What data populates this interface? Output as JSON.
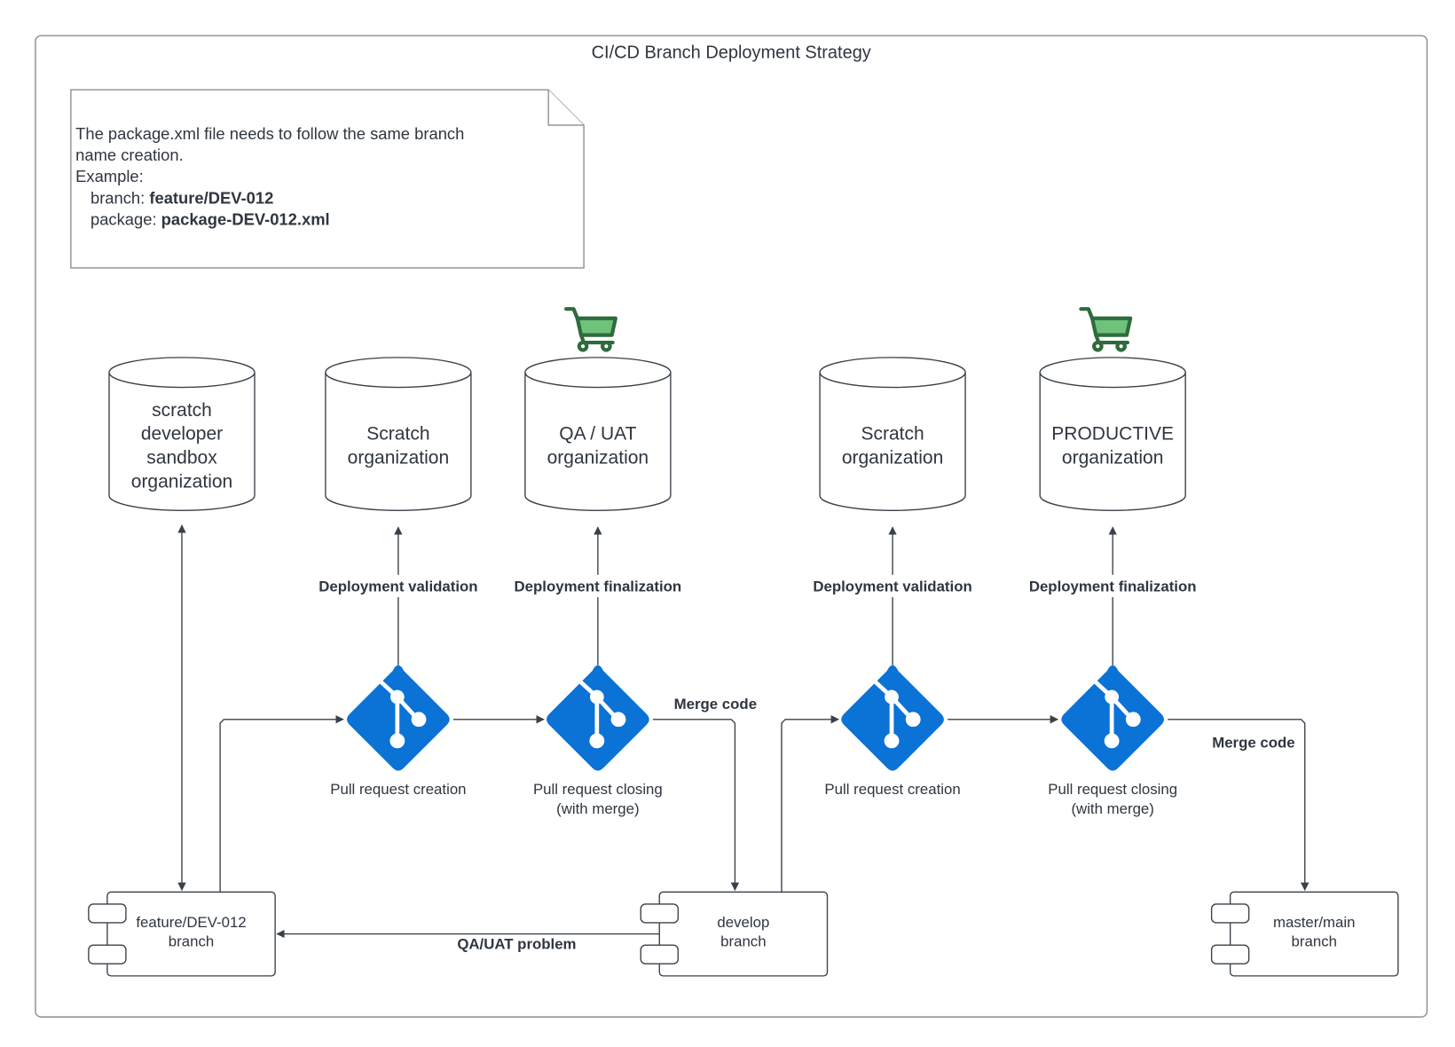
{
  "diagram": {
    "title": "CI/CD Branch Deployment Strategy",
    "note": {
      "line1": "The package.xml file needs to follow the same branch",
      "line2": "name creation.",
      "line3": "Example:",
      "branch_label": "branch: ",
      "branch_value": "feature/DEV-012",
      "package_label": "package: ",
      "package_value": "package-DEV-012.xml"
    },
    "databases": [
      {
        "lines": [
          "scratch",
          "developer",
          "sandbox",
          "organization"
        ],
        "icon": null
      },
      {
        "lines": [
          "Scratch",
          "organization"
        ],
        "icon": null
      },
      {
        "lines": [
          "QA  / UAT",
          "organization"
        ],
        "icon": "shopping-cart-icon"
      },
      {
        "lines": [
          "Scratch",
          "organization"
        ],
        "icon": null
      },
      {
        "lines": [
          "PRODUCTIVE",
          "organization"
        ],
        "icon": "shopping-cart-icon"
      }
    ],
    "deploy_labels": [
      "Deployment validation",
      "Deployment finalization",
      "Deployment validation",
      "Deployment finalization"
    ],
    "git_nodes": [
      {
        "icon": "git-icon",
        "caption": [
          "Pull request creation"
        ]
      },
      {
        "icon": "git-icon",
        "caption": [
          "Pull request closing",
          "(with merge)"
        ]
      },
      {
        "icon": "git-icon",
        "caption": [
          "Pull request creation"
        ]
      },
      {
        "icon": "git-icon",
        "caption": [
          "Pull request closing",
          "(with merge)"
        ]
      }
    ],
    "merge_labels": [
      "Merge code",
      "Merge code"
    ],
    "branches": [
      {
        "lines": [
          "feature/DEV-012",
          "branch"
        ]
      },
      {
        "lines": [
          "develop",
          "branch"
        ]
      },
      {
        "lines": [
          "master/main",
          "branch"
        ]
      }
    ],
    "problem_label": "QA/UAT problem",
    "colors": {
      "git_blue": "#0b72d6",
      "cart_green": "#6fc27a",
      "cart_outline": "#2e6b3b",
      "line": "#3a414a",
      "frame": "#8a8e94"
    }
  }
}
